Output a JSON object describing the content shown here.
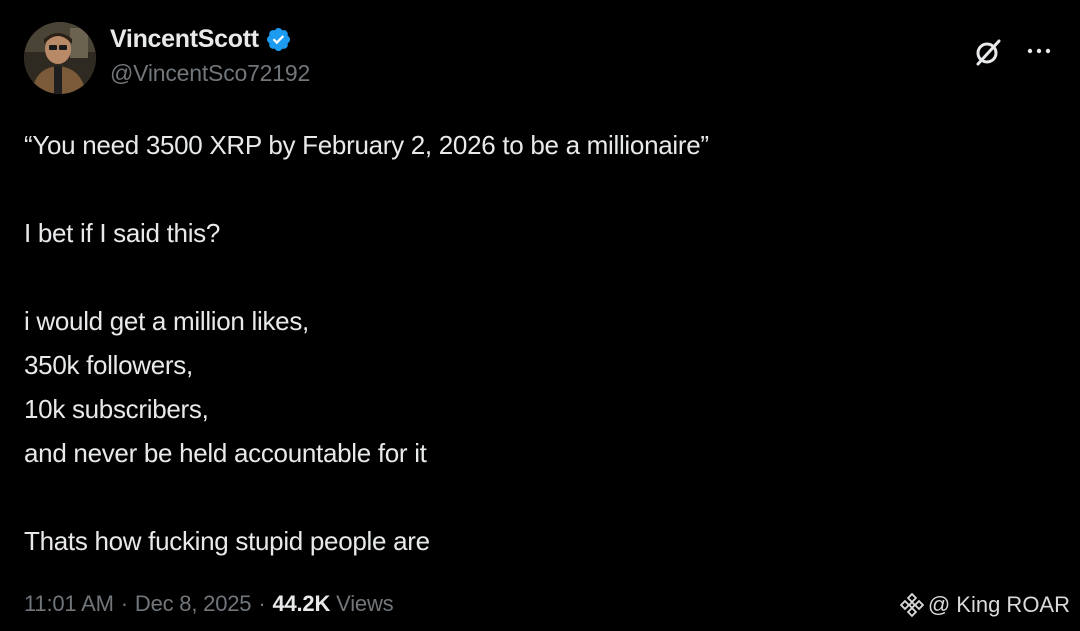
{
  "tweet": {
    "author": {
      "display_name": "VincentScott",
      "handle": "@VincentSco72192",
      "verified": true,
      "verified_color": "#1d9bf0"
    },
    "actions": {
      "grok_icon": "grok-icon",
      "more_icon": "more-icon"
    },
    "text_lines": [
      "“You need 3500 XRP by February 2, 2026 to be a millionaire”",
      "",
      "I bet if I said this?",
      "",
      "i would get a million likes,",
      "350k followers,",
      "10k subscribers,",
      "and never be held accountable for it",
      "",
      "Thats how fucking stupid people are"
    ],
    "meta": {
      "time": "11:01 AM",
      "date": "Dec 8, 2025",
      "separator": "·",
      "views_count": "44.2K",
      "views_label": "Views"
    }
  },
  "watermark": {
    "icon": "binance-logo-icon",
    "text": "@ King ROAR"
  },
  "colors": {
    "background": "#000000",
    "text_primary": "#e7e9ea",
    "text_secondary": "#71767b",
    "accent": "#1d9bf0"
  }
}
